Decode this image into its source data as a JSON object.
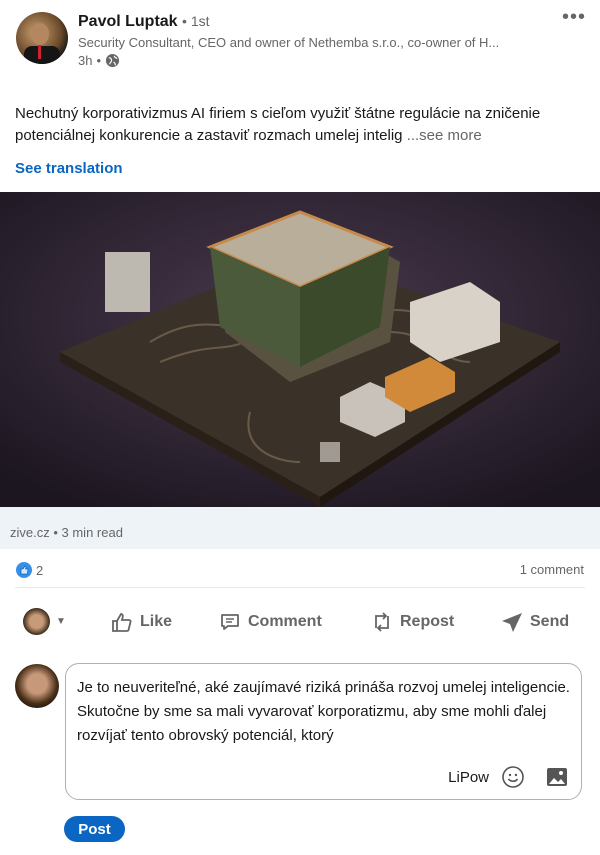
{
  "author": {
    "name": "Pavol Luptak",
    "degree": "1st",
    "headline": "Security Consultant, CEO and owner of Nethemba s.r.o., co-owner of H...",
    "time": "3h"
  },
  "post": {
    "text": "Nechutný korporativizmus AI firiem s cieľom využiť štátne regulácie na zničenie potenciálnej konkurencie a zastaviť rozmach umelej intelig",
    "see_more": "...see more",
    "see_translation": "See translation"
  },
  "article": {
    "source": "zive.cz",
    "read_time": "3 min read"
  },
  "stats": {
    "reactions": "2",
    "comments": "1 comment"
  },
  "actions": {
    "like": "Like",
    "comment": "Comment",
    "repost": "Repost",
    "send": "Send"
  },
  "comment_box": {
    "value": "Je to neuveriteľné, aké zaujímavé riziká prináša rozvoj umelej inteligencie. Skutočne by sme sa mali vyvarovať korporatizmu, aby sme mohli ďalej rozvíjať tento obrovský potenciál, ktorý",
    "extension_label": "LiPow"
  },
  "post_button": "Post",
  "colors": {
    "accent": "#0a66c2",
    "muted": "#666666",
    "source_bg": "#eef3f8"
  }
}
